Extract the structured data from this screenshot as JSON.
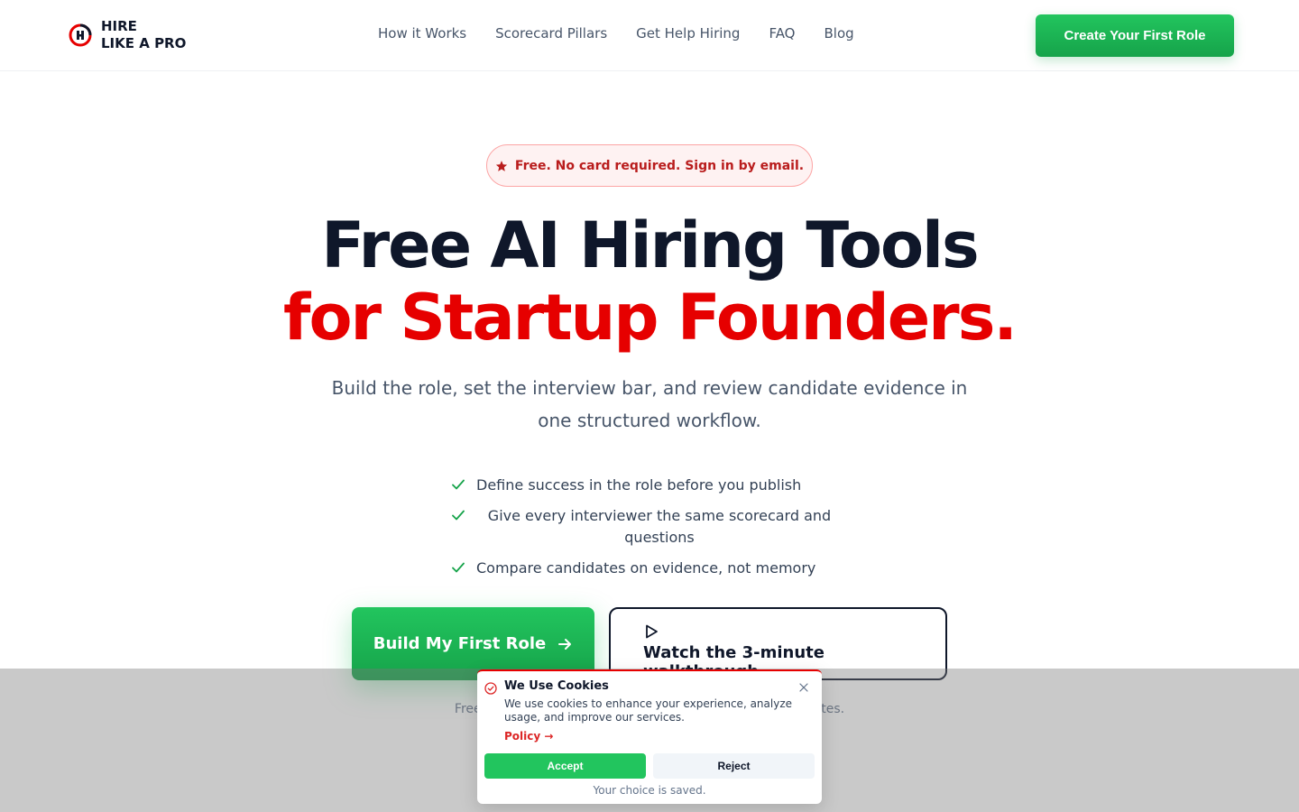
{
  "header": {
    "brand_line1": "HIRE",
    "brand_line2": "LIKE A PRO",
    "nav": [
      "How it Works",
      "Scorecard Pillars",
      "Get Help Hiring",
      "FAQ",
      "Blog"
    ],
    "cta": "Create Your First Role"
  },
  "hero": {
    "badge": "Free. No card required. Sign in by email.",
    "title_line1": "Free AI Hiring Tools",
    "title_line2": "for Startup Founders.",
    "subtitle": "Build the role, set the interview bar, and review candidate evidence in one structured workflow.",
    "checklist": [
      "Define success in the role before you publish",
      "Give every interviewer the same scorecard and questions",
      "Compare candidates on evidence, not memory"
    ],
    "primary_button": "Build My First Role",
    "secondary_button": "Watch the 3-minute walkthrough",
    "fine_print": "Free. No card required. Your first role takes about 15 minutes."
  },
  "cookie": {
    "title": "We Use Cookies",
    "text": "We use cookies to enhance your experience, analyze usage, and improve our services.",
    "policy_link": "Policy →",
    "accept": "Accept",
    "reject": "Reject",
    "note": "Your choice is saved."
  },
  "colors": {
    "brand_red": "#e60000",
    "accent_green": "#22c55e",
    "text_dark": "#0f172a"
  },
  "icons": {
    "logo": "hire-like-a-pro-logo",
    "badge": "star-icon",
    "check": "check-icon",
    "arrow": "arrow-right-icon",
    "play": "play-icon",
    "cookie": "check-circle-icon",
    "close": "close-icon"
  }
}
